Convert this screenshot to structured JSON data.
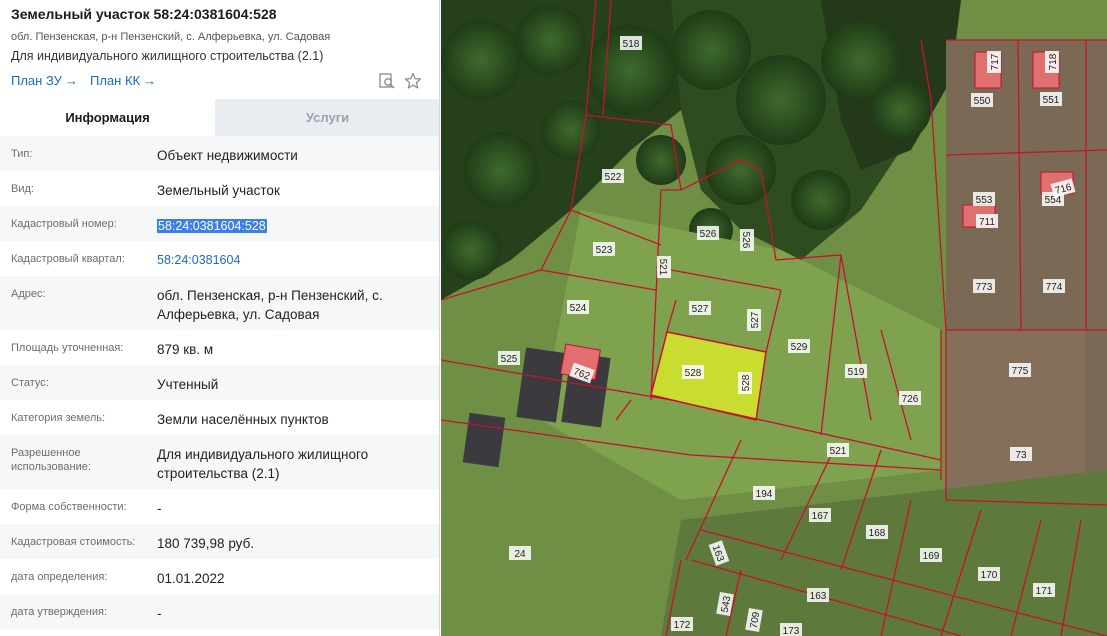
{
  "header": {
    "title": "Земельный участок 58:24:0381604:528",
    "address": "обл. Пензенская, р-н Пензенский, с. Алферьевка, ул. Садовая",
    "purpose": "Для индивидуального жилищного строительства (2.1)",
    "link_plan_zu": "План ЗУ",
    "link_plan_kk": "План КК",
    "arrow": "→",
    "icons": [
      "search-doc-icon",
      "star-icon"
    ]
  },
  "tabs": {
    "info": "Информация",
    "services": "Услуги"
  },
  "rows": [
    {
      "label": "Тип:",
      "value": "Объект недвижимости"
    },
    {
      "label": "Вид:",
      "value": "Земельный участок"
    },
    {
      "label": "Кадастровый номер:",
      "value": "58:24:0381604:528"
    },
    {
      "label": "Кадастровый квартал:",
      "value": "58:24:0381604"
    },
    {
      "label": "Адрес:",
      "value": "обл. Пензенская, р-н Пензенский, с. Алферьевка, ул. Садовая"
    },
    {
      "label": "Площадь уточненная:",
      "value": "879 кв. м"
    },
    {
      "label": "Статус:",
      "value": "Учтенный"
    },
    {
      "label": "Категория земель:",
      "value": "Земли населённых пунктов"
    },
    {
      "label": "Разрешенное использование:",
      "value": "Для индивидуального жилищного строительства (2.1)"
    },
    {
      "label": "Форма собственности:",
      "value": "-"
    },
    {
      "label": "Кадастровая стоимость:",
      "value": "180 739,98 руб."
    },
    {
      "label": "дата определения:",
      "value": "01.01.2022"
    },
    {
      "label": "дата утверждения:",
      "value": "-"
    }
  ],
  "map": {
    "parcel_labels": [
      "518",
      "522",
      "523",
      "524",
      "525",
      "526",
      "526",
      "521",
      "527",
      "527",
      "528",
      "528",
      "529",
      "519",
      "726",
      "762",
      "521",
      "194",
      "167",
      "168",
      "24",
      "163",
      "163",
      "543",
      "709",
      "172",
      "173",
      "717",
      "718",
      "550",
      "551",
      "553",
      "711",
      "554",
      "716",
      "773",
      "774",
      "775",
      "73",
      "169",
      "170",
      "171"
    ],
    "colors": {
      "boundary": "#c8102e",
      "selected_fill": "#d6e82a",
      "structure": "#e07070"
    }
  }
}
